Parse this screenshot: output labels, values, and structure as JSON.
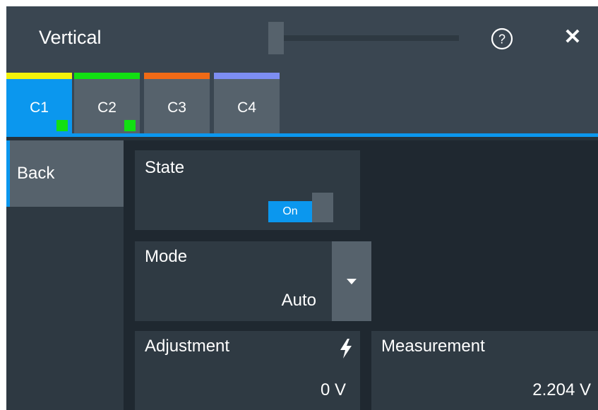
{
  "dialog": {
    "title": "Vertical"
  },
  "header": {
    "help_icon": "help-icon",
    "close_icon": "close-icon",
    "close_glyph": "✕"
  },
  "tabs": [
    {
      "label": "C1",
      "color": "#f2f20a",
      "active": true,
      "indicator": true
    },
    {
      "label": "C2",
      "color": "#12e012",
      "active": false,
      "indicator": true
    },
    {
      "label": "C3",
      "color": "#f06a16",
      "active": false,
      "indicator": false
    },
    {
      "label": "C4",
      "color": "#7d8ef2",
      "active": false,
      "indicator": false
    }
  ],
  "nav": {
    "back_label": "Back"
  },
  "state": {
    "label": "State",
    "toggle_label": "On"
  },
  "mode": {
    "label": "Mode",
    "value": "Auto"
  },
  "adjustment": {
    "label": "Adjustment",
    "value": "0 V",
    "icon": "lightning-bolt-icon"
  },
  "measurement": {
    "label": "Measurement",
    "value": "2.204 V"
  },
  "colors": {
    "accent": "#0b97ee",
    "active_indicator": "#12e012"
  }
}
